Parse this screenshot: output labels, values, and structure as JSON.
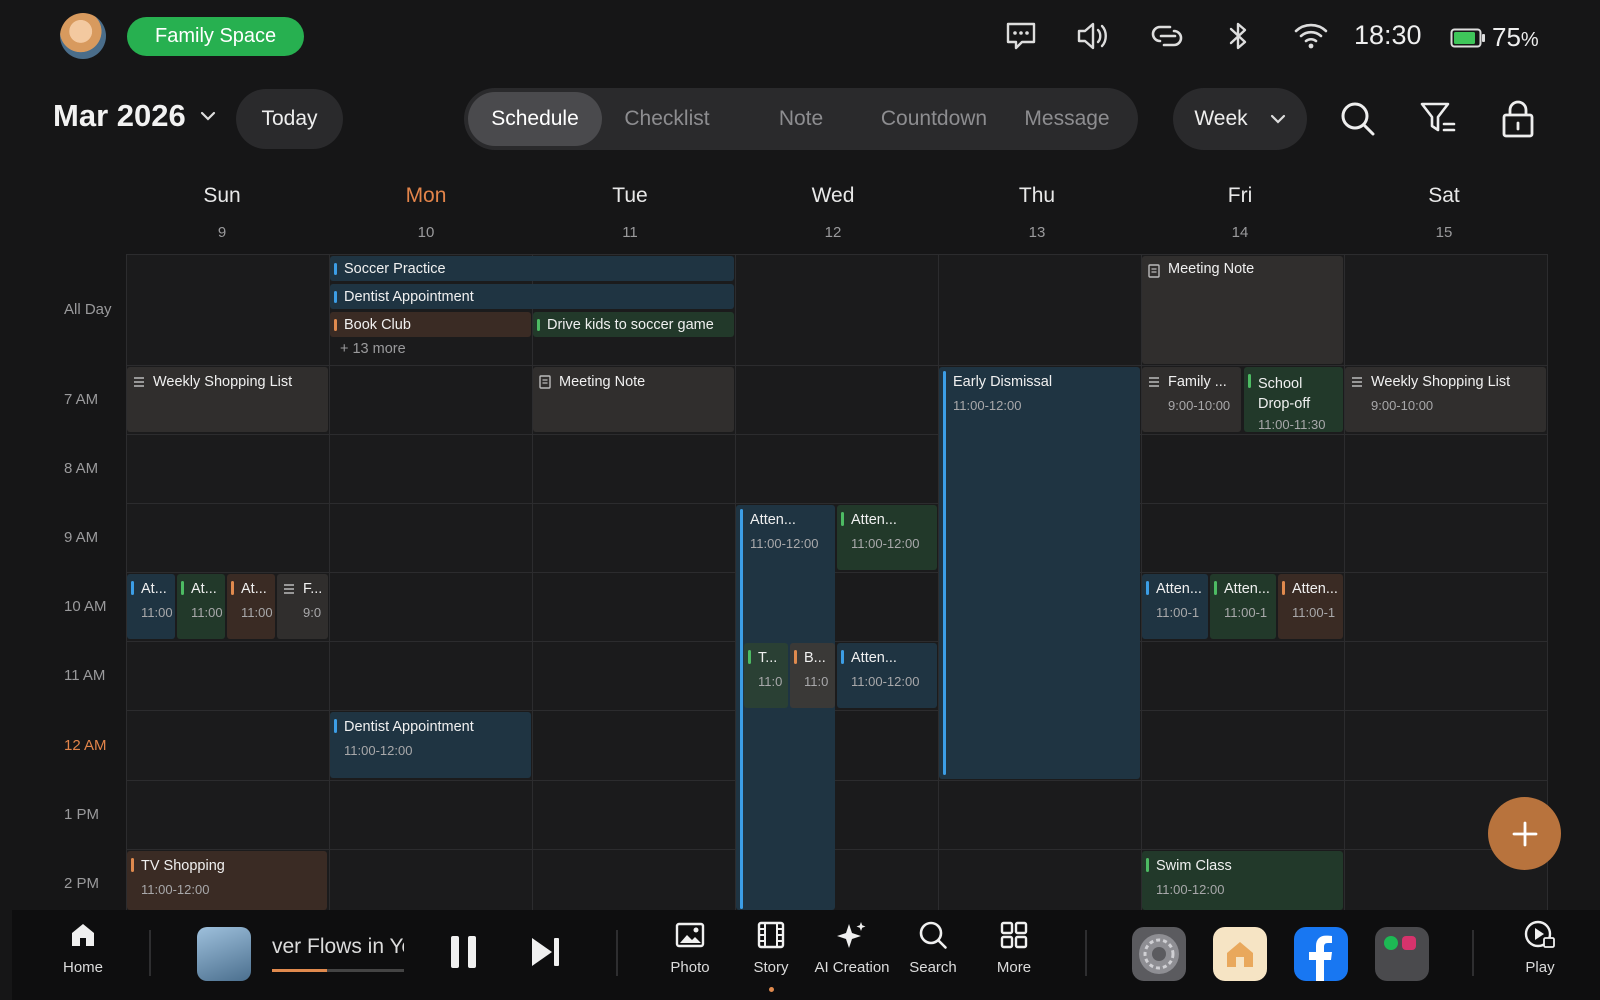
{
  "status_bar": {
    "space_label": "Family Space",
    "time": "18:30",
    "battery": "75",
    "battery_unit": "%",
    "icons": [
      "message-icon",
      "volume-icon",
      "link-icon",
      "bluetooth-icon",
      "wifi-icon",
      "battery-icon"
    ]
  },
  "header": {
    "month_label": "Mar 2026",
    "today_label": "Today",
    "tabs": [
      {
        "label": "Schedule",
        "active": true
      },
      {
        "label": "Checklist",
        "active": false
      },
      {
        "label": "Note",
        "active": false
      },
      {
        "label": "Countdown",
        "active": false
      },
      {
        "label": "Message",
        "active": false
      }
    ],
    "view_label": "Week",
    "icons": [
      "search-icon",
      "filter-icon",
      "lock-icon"
    ]
  },
  "days": [
    {
      "name": "Sun",
      "num": "9"
    },
    {
      "name": "Mon",
      "num": "10",
      "today": true
    },
    {
      "name": "Tue",
      "num": "11"
    },
    {
      "name": "Wed",
      "num": "12"
    },
    {
      "name": "Thu",
      "num": "13"
    },
    {
      "name": "Fri",
      "num": "14"
    },
    {
      "name": "Sat",
      "num": "15"
    }
  ],
  "row_labels": [
    "All Day",
    "7 AM",
    "8 AM",
    "9 AM",
    "10 AM",
    "11 AM",
    "12 AM",
    "1 PM",
    "2 PM"
  ],
  "all_day": {
    "soccer_practice": "Soccer Practice",
    "dentist": "Dentist Appointment",
    "book_club": "Book Club",
    "drive_kids": "Drive kids to soccer game",
    "more": "+ 13 more",
    "meeting_note_fri": "Meeting Note"
  },
  "events": {
    "sun_shopping": {
      "title": "Weekly Shopping List"
    },
    "tue_meeting": {
      "title": "Meeting Note"
    },
    "thu_early": {
      "title": "Early Dismissal",
      "time": "11:00-12:00"
    },
    "fri_family": {
      "title": "Family ...",
      "time": "9:00-10:00"
    },
    "fri_school": {
      "title": "School Drop-off",
      "time": "11:00-11:30"
    },
    "sat_shopping": {
      "title": "Weekly Shopping List",
      "time": "9:00-10:00"
    },
    "wed_att1": {
      "title": "Atten...",
      "time": "11:00-12:00"
    },
    "wed_att2": {
      "title": "Atten...",
      "time": "11:00-12:00"
    },
    "sun_a1": {
      "title": "At...",
      "time": "11:00"
    },
    "sun_a2": {
      "title": "At...",
      "time": "11:00"
    },
    "sun_a3": {
      "title": "At...",
      "time": "11:00"
    },
    "sun_f": {
      "title": "F...",
      "time": "9:0"
    },
    "fri_att1": {
      "title": "Atten...",
      "time": "11:00-1"
    },
    "fri_att2": {
      "title": "Atten...",
      "time": "11:00-1"
    },
    "fri_att3": {
      "title": "Atten...",
      "time": "11:00-1"
    },
    "wed_t": {
      "title": "T...",
      "time": "11:0"
    },
    "wed_b": {
      "title": "B...",
      "time": "11:0"
    },
    "wed_att3": {
      "title": "Atten...",
      "time": "11:00-12:00"
    },
    "mon_dentist": {
      "title": "Dentist Appointment",
      "time": "11:00-12:00"
    },
    "sun_tv": {
      "title": "TV Shopping",
      "time": "11:00-12:00"
    },
    "fri_swim": {
      "title": "Swim Class",
      "time": "11:00-12:00"
    }
  },
  "dock": {
    "home": "Home",
    "media_title": "ver Flows in Yo",
    "media_progress": 0.42,
    "photo": "Photo",
    "story": "Story",
    "ai": "AI Creation",
    "search": "Search",
    "more": "More",
    "play": "Play",
    "apps": [
      "settings-app",
      "home-app",
      "facebook-app",
      "social-folder"
    ]
  },
  "colors": {
    "accent": "#e2844a",
    "green": "#27b050",
    "blue": "#3c9ee6",
    "fab": "#b8733d"
  }
}
